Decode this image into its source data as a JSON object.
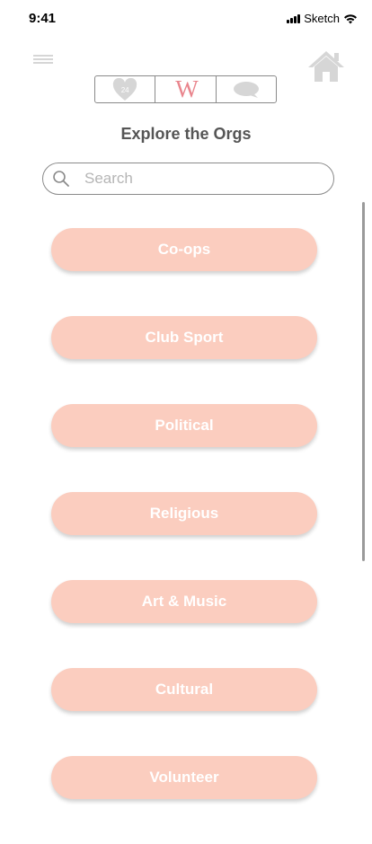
{
  "status_bar": {
    "time": "9:41",
    "carrier": "Sketch"
  },
  "header": {
    "menu_icon": "hamburger-icon",
    "home_icon": "home-icon",
    "segments": [
      {
        "icon": "heart-icon",
        "badge": "24"
      },
      {
        "icon": "logo-w-icon",
        "letter": "W"
      },
      {
        "icon": "chat-bubble-icon"
      }
    ]
  },
  "title": "Explore the Orgs",
  "search": {
    "placeholder": "Search",
    "value": ""
  },
  "categories": [
    "Co-ops",
    "Club Sport",
    "Political",
    "Religious",
    "Art & Music",
    "Cultural",
    "Volunteer"
  ],
  "colors": {
    "accent_button": "#fbcdbf",
    "logo": "#e9858d",
    "icon_gray": "#d6d6d6"
  }
}
